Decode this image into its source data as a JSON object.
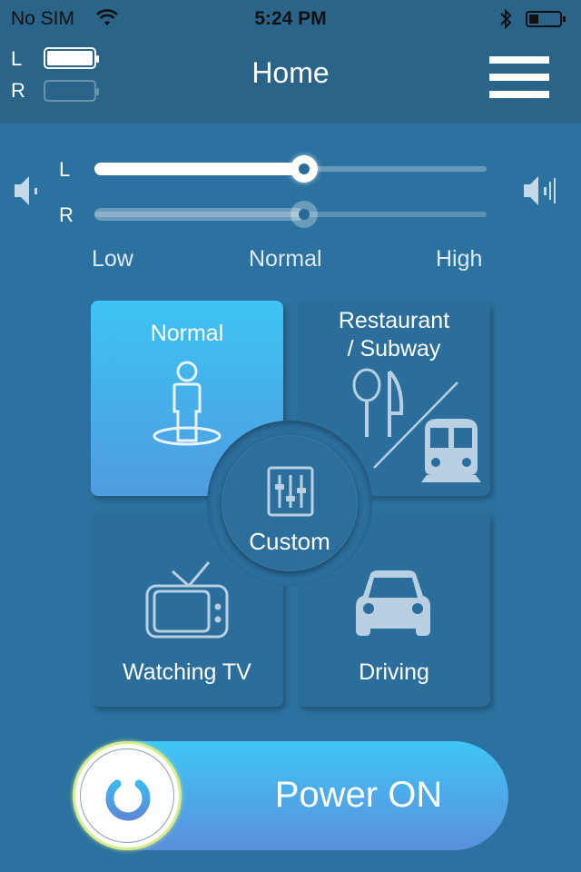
{
  "status_bar": {
    "carrier": "No SIM",
    "time": "5:24 PM",
    "wifi_icon": "wifi-icon",
    "bluetooth_icon": "bluetooth-icon",
    "battery_level": 0.2
  },
  "header": {
    "title": "Home",
    "left_label": "L",
    "right_label": "R",
    "left_battery": "full",
    "right_battery": "empty",
    "menu_icon": "hamburger-menu-icon"
  },
  "volume": {
    "min_icon": "speaker-low-icon",
    "max_icon": "speaker-high-icon",
    "left": {
      "label": "L",
      "value": 0.5,
      "active": true
    },
    "right": {
      "label": "R",
      "value": 0.5,
      "active": false
    },
    "scale": [
      "Low",
      "Normal",
      "High"
    ]
  },
  "modes": {
    "normal": {
      "label": "Normal",
      "icon": "person-standing-icon",
      "active": true
    },
    "restaurant": {
      "label_line1": "Restaurant",
      "label_line2": "/ Subway",
      "icon": "restaurant-subway-icon"
    },
    "custom": {
      "label": "Custom",
      "icon": "equalizer-icon"
    },
    "tv": {
      "label": "Watching TV",
      "icon": "tv-icon"
    },
    "driving": {
      "label": "Driving",
      "icon": "car-icon"
    }
  },
  "power": {
    "label": "Power ON",
    "icon": "power-icon",
    "state": "on"
  },
  "colors": {
    "accent_start": "#3dc3f5",
    "accent_end": "#5b8fdc",
    "background": "#2c72a0",
    "header": "#2a6489"
  }
}
